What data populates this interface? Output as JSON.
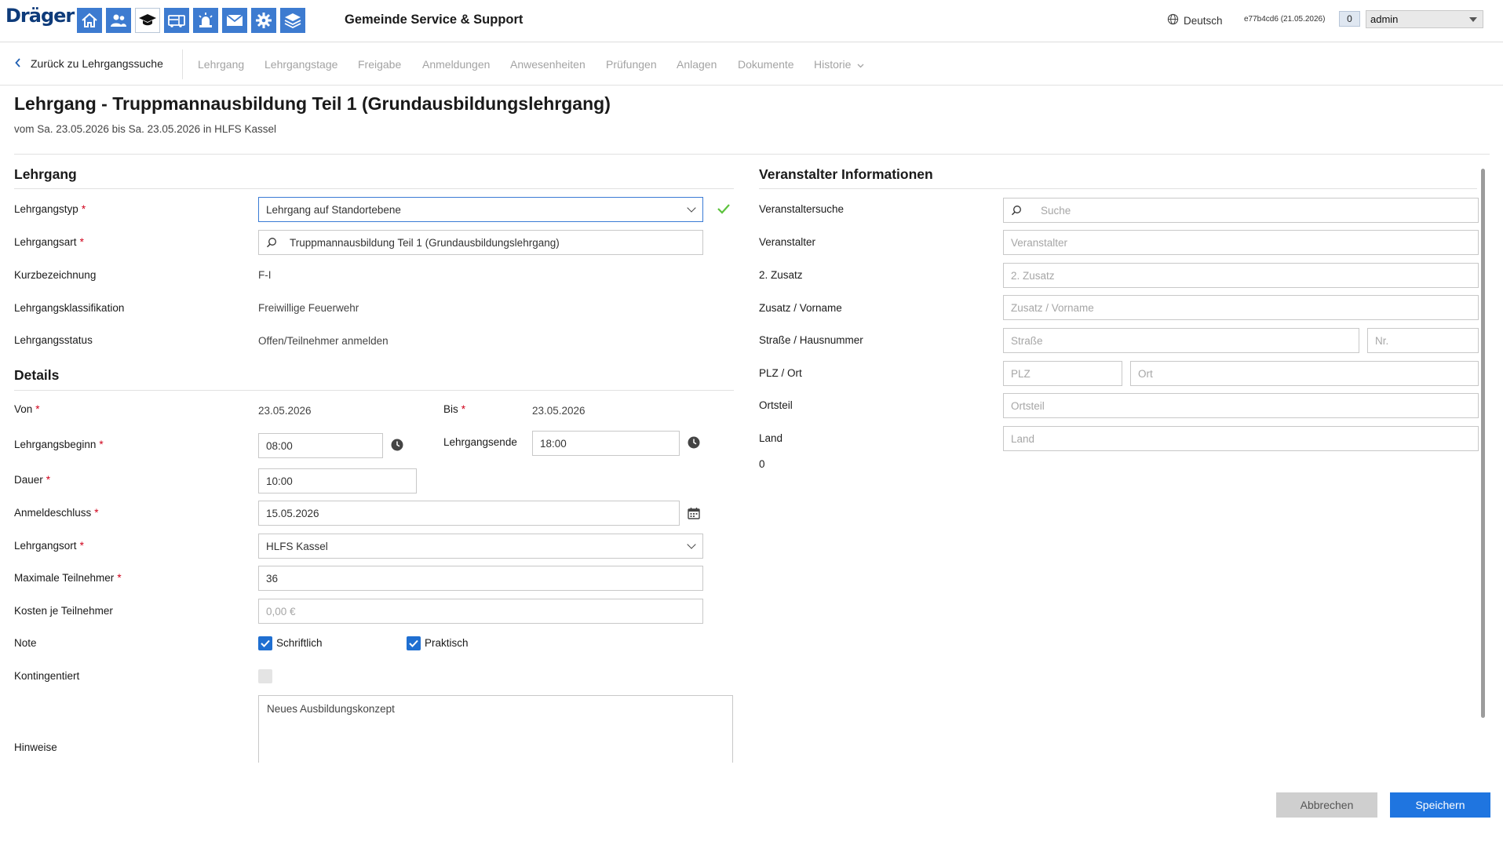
{
  "header": {
    "logo": "Dräger",
    "app_title": "Gemeinde Service & Support",
    "language": "Deutsch",
    "version": "e77b4cd6 (21.05.2026)",
    "notifications": "0",
    "user": "admin",
    "nav_icons": [
      "home-icon",
      "users-icon",
      "graduation-cap-icon",
      "fire-truck-icon",
      "alarm-light-icon",
      "mail-icon",
      "gear-icon",
      "layers-icon"
    ]
  },
  "tabbar": {
    "back": "Zurück zu Lehrgangssuche",
    "tabs": [
      "Lehrgang",
      "Lehrgangstage",
      "Freigabe",
      "Anmeldungen",
      "Anwesenheiten",
      "Prüfungen",
      "Anlagen",
      "Dokumente",
      "Historie"
    ]
  },
  "page": {
    "title": "Lehrgang - Truppmannausbildung Teil 1 (Grundausbildungslehrgang)",
    "subtitle": "vom Sa. 23.05.2026 bis Sa. 23.05.2026 in HLFS Kassel"
  },
  "lehrgang": {
    "section": "Lehrgang",
    "typ_label": "Lehrgangstyp",
    "typ_value": "Lehrgang auf Standortebene",
    "art_label": "Lehrgangsart",
    "art_value": "Truppmannausbildung Teil 1 (Grundausbildungslehrgang)",
    "kurz_label": "Kurzbezeichnung",
    "kurz_value": "F-I",
    "klass_label": "Lehrgangsklassifikation",
    "klass_value": "Freiwillige Feuerwehr",
    "status_label": "Lehrgangsstatus",
    "status_value": "Offen/Teilnehmer anmelden"
  },
  "details": {
    "section": "Details",
    "von_label": "Von",
    "von_value": "23.05.2026",
    "bis_label": "Bis",
    "bis_value": "23.05.2026",
    "beginn_label": "Lehrgangsbeginn",
    "beginn_value": "08:00",
    "ende_label": "Lehrgangsende",
    "ende_value": "18:00",
    "dauer_label": "Dauer",
    "dauer_value": "10:00",
    "anmeldeschluss_label": "Anmeldeschluss",
    "anmeldeschluss_value": "15.05.2026",
    "ort_label": "Lehrgangsort",
    "ort_value": "HLFS Kassel",
    "max_label": "Maximale Teilnehmer",
    "max_value": "36",
    "kosten_label": "Kosten je Teilnehmer",
    "kosten_value": "0,00 €",
    "note_label": "Note",
    "schriftlich": "Schriftlich",
    "praktisch": "Praktisch",
    "kontingent_label": "Kontingentiert",
    "hinweise_label": "Hinweise",
    "hinweise_value": "Neues Ausbildungskonzept"
  },
  "veranstalter": {
    "section": "Veranstalter Informationen",
    "suche_label": "Veranstaltersuche",
    "suche_ph": "Suche",
    "veranstalter_label": "Veranstalter",
    "veranstalter_ph": "Veranstalter",
    "zusatz2_label": "2. Zusatz",
    "zusatz2_ph": "2. Zusatz",
    "vorname_label": "Zusatz / Vorname",
    "vorname_ph": "Zusatz / Vorname",
    "strasse_label": "Straße / Hausnummer",
    "strasse_ph": "Straße",
    "nr_ph": "Nr.",
    "plzort_label": "PLZ / Ort",
    "plz_ph": "PLZ",
    "ort_ph": "Ort",
    "ortsteil_label": "Ortsteil",
    "ortsteil_ph": "Ortsteil",
    "land_label": "Land",
    "land_ph": "Land",
    "counter": "0"
  },
  "actions": {
    "cancel": "Abbrechen",
    "save": "Speichern"
  },
  "colors": {
    "brand_blue": "#3d7bd0",
    "primary_button": "#1f75e0",
    "required": "#d0021b",
    "valid_check": "#5cc23d"
  }
}
